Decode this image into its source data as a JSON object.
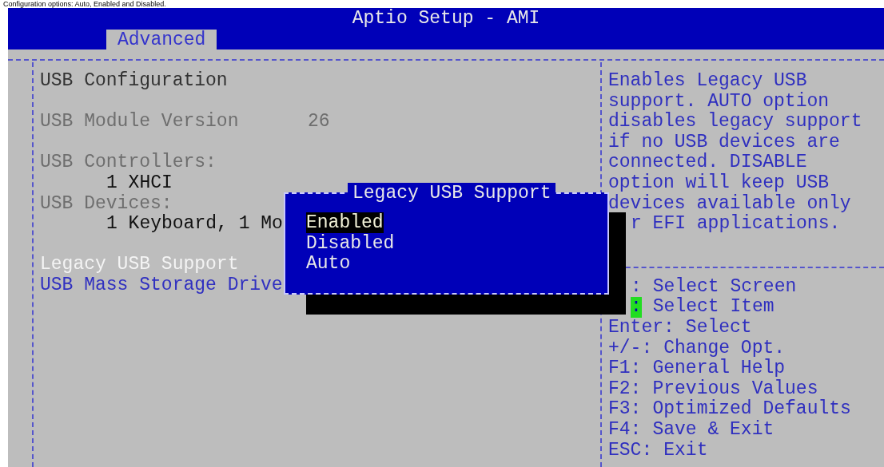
{
  "caption": "Configuration options: Auto, Enabled and Disabled.",
  "window": {
    "title": "Aptio Setup - AMI"
  },
  "tabs": [
    {
      "label": "Advanced",
      "selected": true
    }
  ],
  "items": [
    {
      "kind": "heading",
      "label": "USB Configuration"
    },
    {
      "kind": "info",
      "label": "USB Module Version",
      "value": "26"
    },
    {
      "kind": "info",
      "label": "USB Controllers:"
    },
    {
      "kind": "detail",
      "label": "1 XHCI"
    },
    {
      "kind": "info",
      "label": "USB Devices:"
    },
    {
      "kind": "detail",
      "label": "1 Keyboard, 1 Mo"
    },
    {
      "kind": "option",
      "label": "Legacy USB Support",
      "selected": true
    },
    {
      "kind": "option",
      "label": "USB Mass Storage Drive",
      "selected": false
    }
  ],
  "help": [
    "Enables Legacy USB",
    "support. AUTO option",
    "disables legacy support",
    "if no USB devices are",
    "connected. DISABLE",
    "option will keep USB",
    "devices available only",
    "r EFI applications."
  ],
  "keys": [
    {
      "key": ":",
      "action": "Select Screen",
      "highlighted": false
    },
    {
      "key": ":",
      "action": "Select Item",
      "highlighted": true
    },
    {
      "key": "Enter:",
      "action": "Select",
      "highlighted": false
    },
    {
      "key": "+/-:",
      "action": "Change Opt.",
      "highlighted": false
    },
    {
      "key": "F1:",
      "action": "General Help",
      "highlighted": false
    },
    {
      "key": "F2:",
      "action": "Previous Values",
      "highlighted": false
    },
    {
      "key": "F3:",
      "action": "Optimized Defaults",
      "highlighted": false
    },
    {
      "key": "F4:",
      "action": "Save & Exit",
      "highlighted": false
    },
    {
      "key": "ESC:",
      "action": "Exit",
      "highlighted": false
    }
  ],
  "popup": {
    "title": "Legacy USB Support",
    "options": [
      {
        "label": "Enabled",
        "selected": true
      },
      {
        "label": "Disabled",
        "selected": false
      },
      {
        "label": "Auto",
        "selected": false
      }
    ]
  }
}
